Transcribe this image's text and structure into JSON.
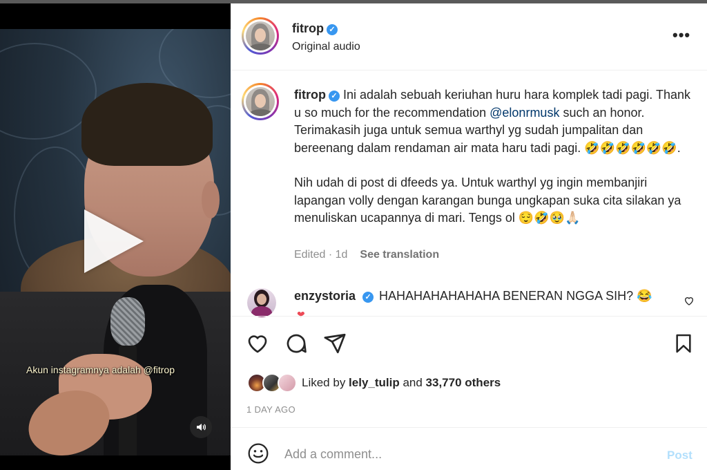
{
  "post": {
    "username": "fitrop",
    "audio": "Original audio",
    "video_caption": "Akun instagramnya adalah @fitrop",
    "caption": {
      "line1_pre": "Ini adalah sebuah keriuhan huru hara komplek tadi pagi. Thank u so much for the recommendation ",
      "mention": "@elonrmusk",
      "line1_post": " such an honor. Terimakasih juga untuk semua warthyl yg sudah jumpalitan dan bereenang dalam rendaman air mata haru tadi pagi. 🤣🤣🤣🤣🤣🤣.",
      "paragraph2": "Nih udah di post di dfeeds ya. Untuk warthyl yg ingin membanjiri lapangan volly dengan karangan bunga ungkapan suka cita silakan ya menuliskan ucapannya di mari. Tengs ol 😌🤣🥹🙏🏻"
    },
    "edited": "Edited · 1d",
    "see_translation": "See translation"
  },
  "comment": {
    "username": "enzystoria",
    "text": "HAHAHAHAHAHAHA BENERAN NGGA SIH? 😂",
    "heart": "❤"
  },
  "likes": {
    "prefix": "Liked by ",
    "user": "lely_tulip",
    "middle": " and ",
    "count": "33,770 others"
  },
  "time_ago": "1 DAY AGO",
  "add_comment": {
    "placeholder": "Add a comment...",
    "post_label": "Post"
  },
  "icons": {
    "more": "•••",
    "verified": "✓",
    "sound": "🔊"
  },
  "colors": {
    "verified_blue": "#3897f0",
    "mention": "#00376b",
    "post_disabled": "#b2dffc",
    "heart_red": "#ed4956"
  }
}
